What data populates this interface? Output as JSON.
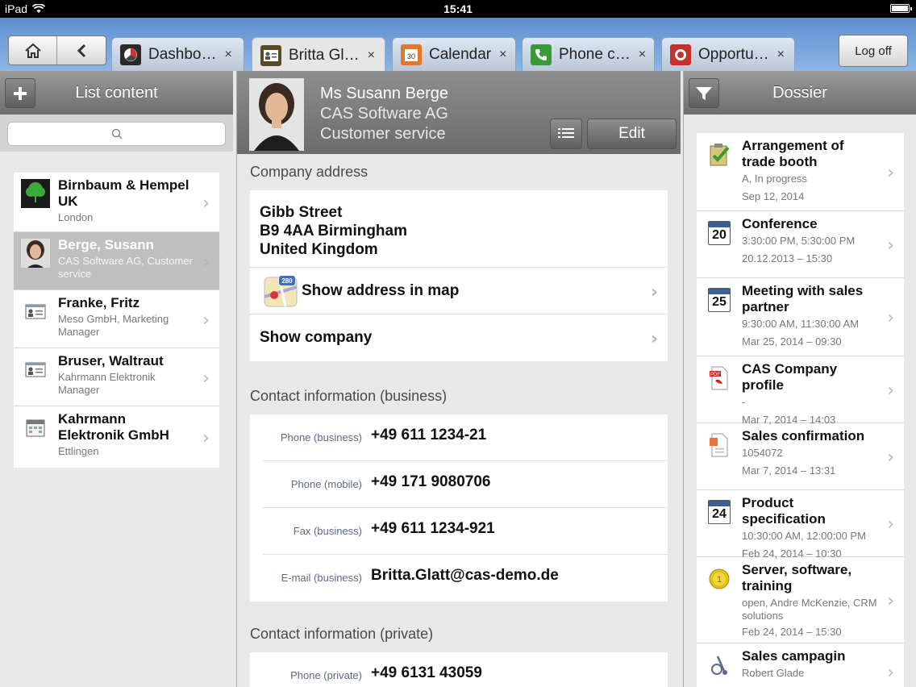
{
  "status": {
    "device": "iPad",
    "time": "15:41"
  },
  "tabs": [
    {
      "label": "Dashbo…",
      "color": "#2a2a2a"
    },
    {
      "label": "Britta Gl…",
      "color": "#5a4a2a"
    },
    {
      "label": "Calendar",
      "color": "#e07a2a"
    },
    {
      "label": "Phone c…",
      "color": "#3a9a3a"
    },
    {
      "label": "Opportu…",
      "color": "#c8302a"
    }
  ],
  "tab_close": "×",
  "logoff_label": "Log off",
  "left": {
    "title": "List content",
    "items": [
      {
        "title": "Birnbaum & Hempel UK",
        "sub": "London",
        "icon": "tree-logo-icon"
      },
      {
        "title": "Berge, Susann",
        "sub": "CAS Software AG, Customer  service",
        "icon": "contact-photo-icon"
      },
      {
        "title": "Franke, Fritz",
        "sub": "Meso GmbH, Marketing Manager",
        "icon": "contact-card-icon"
      },
      {
        "title": "Bruser, Waltraut",
        "sub": "Kahrmann Elektronik Manager",
        "icon": "contact-card-icon"
      },
      {
        "title": "Kahrmann Elektronik GmbH",
        "sub": "Ettlingen",
        "icon": "company-icon"
      }
    ]
  },
  "contact": {
    "name": "Ms Susann Berge",
    "company": "CAS Software AG",
    "department": "Customer service",
    "edit_label": "Edit"
  },
  "company_address": {
    "heading": "Company address",
    "lines": [
      "Gibb Street",
      "B9 4AA Birmingham",
      "United Kingdom"
    ],
    "map_label": "Show address in map",
    "company_label": "Show company"
  },
  "business": {
    "heading": "Contact information (business)",
    "rows": [
      {
        "key": "Phone (business)",
        "value": "+49 611 1234-21"
      },
      {
        "key": "Phone (mobile)",
        "value": "+49 171 9080706"
      },
      {
        "key": "Fax (business)",
        "value": "+49 611 1234-921"
      },
      {
        "key": "E-mail (business)",
        "value": "Britta.Glatt@cas-demo.de"
      }
    ]
  },
  "private": {
    "heading": "Contact information (private)",
    "rows": [
      {
        "key": "Phone (private)",
        "value": "+49 6131 43059"
      }
    ]
  },
  "dossier": {
    "title": "Dossier",
    "items": [
      {
        "title": "Arrangement of trade booth",
        "sub": "A, In progress",
        "date": "Sep 12, 2014",
        "icon": "task-check-icon"
      },
      {
        "title": "Conference",
        "sub": "3:30:00 PM, 5:30:00 PM",
        "date": "20.12.2013 – 15:30",
        "icon": "calendar-icon",
        "day": "20"
      },
      {
        "title": "Meeting with sales partner",
        "sub": "9:30:00 AM, 11:30:00 AM",
        "date": "Mar 25, 2014 – 09:30",
        "icon": "calendar-icon",
        "day": "25"
      },
      {
        "title": "CAS Company profile",
        "sub": "-",
        "date": "Mar 7, 2014 – 14:03",
        "icon": "pdf-document-icon"
      },
      {
        "title": "Sales confirmation",
        "sub": "1054072",
        "date": "Mar 7, 2014 – 13:31",
        "icon": "document-icon"
      },
      {
        "title": "Product specification",
        "sub": "10:30:00 AM, 12:00:00 PM",
        "date": "Feb 24, 2014 – 10:30",
        "icon": "calendar-icon",
        "day": "24"
      },
      {
        "title": "Server, software, training",
        "sub": "open,   Andre McKenzie, CRM solutions",
        "date": "Feb 24, 2014 – 15:30",
        "icon": "opportunity-coin-icon"
      },
      {
        "title": "Sales campagin",
        "sub": "Robert Glade",
        "date": "",
        "icon": "campaign-icon"
      }
    ]
  }
}
